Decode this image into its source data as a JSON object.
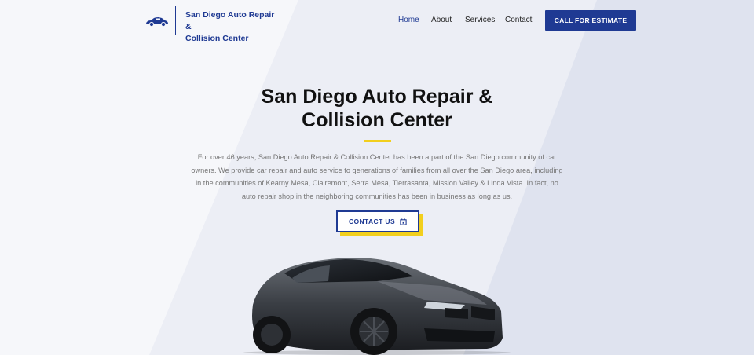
{
  "header": {
    "logo_line1": "San Diego Auto Repair &",
    "logo_line2": "Collision Center",
    "logo_icon": "car-logo-icon",
    "nav": [
      "Home",
      "About",
      "Services",
      "Contact"
    ],
    "active_nav": "Home",
    "cta_label": "CALL FOR ESTIMATE"
  },
  "hero": {
    "title_line1": "San Diego Auto Repair &",
    "title_line2": "Collision Center",
    "description": "For over 46 years, San Diego Auto Repair & Collision Center has been a part of the San Diego community of car owners. We provide car repair and auto service to generations of families from all over the San Diego area, including in the communities of Kearny Mesa, Clairemont, Serra Mesa, Tierrasanta, Mission Valley & Linda Vista. In fact, no auto repair shop in the neighboring communities has been in business as long as us.",
    "contact_label": "CONTACT US",
    "contact_icon": "calendar-icon"
  },
  "colors": {
    "brand": "#1f3a93",
    "accent": "#f2cf1d"
  }
}
